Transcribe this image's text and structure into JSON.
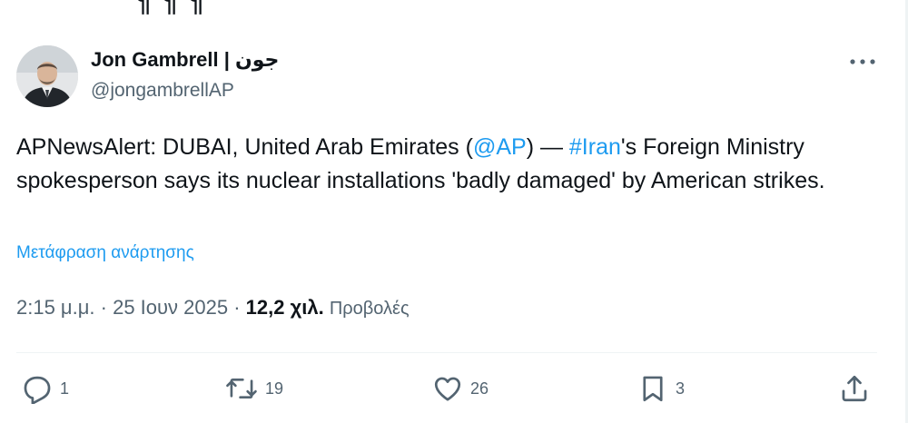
{
  "header": {
    "fragment": "¶ ¶ ¶"
  },
  "tweet": {
    "author": {
      "name": "Jon Gambrell | جون",
      "handle": "@jongambrellAP"
    },
    "text": {
      "part1": "APNewsAlert: DUBAI, United Arab Emirates (",
      "mention": "@AP",
      "part2": ") — ",
      "hashtag": "#Iran",
      "part3": "'s Foreign Ministry spokesperson says its nuclear installations 'badly damaged' by American strikes."
    },
    "translate_label": "Μετάφραση ανάρτησης",
    "meta": {
      "time": "2:15 μ.μ.",
      "separator": " · ",
      "date": "25 Ιουν 2025",
      "separator2": " · ",
      "views_count": "12,2 χιλ.",
      "views_label": "Προβολές"
    },
    "actions": {
      "reply": {
        "icon": "reply-icon",
        "count": "1"
      },
      "retweet": {
        "icon": "retweet-icon",
        "count": "19"
      },
      "like": {
        "icon": "heart-icon",
        "count": "26"
      },
      "bookmark": {
        "icon": "bookmark-icon",
        "count": "3"
      },
      "share": {
        "icon": "share-icon"
      }
    },
    "colors": {
      "link": "#1d9bf0",
      "text": "#0f1419",
      "secondary": "#536471",
      "divider": "#eff3f4"
    }
  }
}
